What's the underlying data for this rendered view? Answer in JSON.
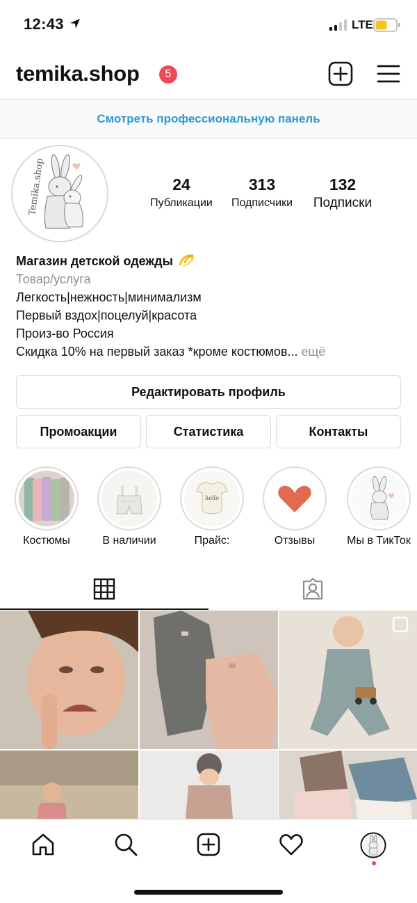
{
  "status_bar": {
    "time": "12:43",
    "network": "LTE",
    "battery_color": "#f5c518"
  },
  "header": {
    "username": "temika.shop",
    "notification_count": "5"
  },
  "pro_panel": {
    "label": "Смотреть профессиональную панель"
  },
  "avatar": {
    "logo_text": "Temika.shop"
  },
  "stats": {
    "posts": {
      "count": "24",
      "label": "Публикации"
    },
    "followers": {
      "count": "313",
      "label": "Подписчики"
    },
    "following": {
      "count": "132",
      "label": "Подписки"
    }
  },
  "bio": {
    "name": "Магазин детской одежды",
    "category": "Товар/услуга",
    "lines": [
      "Легкость|нежность|минимализм",
      "Первый вздох|поцелуй|красота",
      "Произ-во Россия",
      "Скидка 10% на первый заказ *кроме костюмов..."
    ],
    "more": "ещё"
  },
  "buttons": {
    "edit_profile": "Редактировать профиль",
    "promotions": "Промоакции",
    "insights": "Статистика",
    "contacts": "Контакты"
  },
  "highlights": [
    {
      "label": "Костюмы"
    },
    {
      "label": "В наличии"
    },
    {
      "label": "Прайс:"
    },
    {
      "label": "Отзывы"
    },
    {
      "label": "Мы в ТикТок"
    }
  ],
  "tabs": [
    {
      "name": "grid",
      "icon": "grid-icon",
      "active": true
    },
    {
      "name": "tagged",
      "icon": "tagged-person-icon",
      "active": false
    }
  ],
  "bottom_nav": [
    {
      "icon": "home-icon"
    },
    {
      "icon": "search-icon"
    },
    {
      "icon": "add-post-icon"
    },
    {
      "icon": "heart-icon"
    },
    {
      "icon": "profile-avatar-icon"
    }
  ],
  "colors": {
    "accent_link": "#2b9bd6",
    "badge_red": "#ed4956",
    "border": "#dbdbdb",
    "muted_text": "#8e8e8e"
  }
}
